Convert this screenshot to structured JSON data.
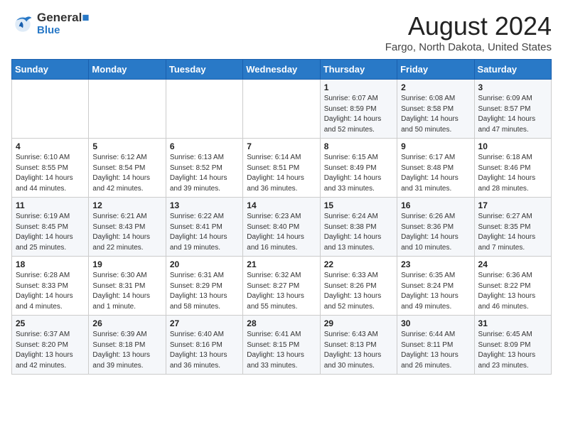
{
  "header": {
    "logo_line1": "General",
    "logo_line2": "Blue",
    "title": "August 2024",
    "subtitle": "Fargo, North Dakota, United States"
  },
  "weekdays": [
    "Sunday",
    "Monday",
    "Tuesday",
    "Wednesday",
    "Thursday",
    "Friday",
    "Saturday"
  ],
  "weeks": [
    [
      {
        "day": "",
        "info": ""
      },
      {
        "day": "",
        "info": ""
      },
      {
        "day": "",
        "info": ""
      },
      {
        "day": "",
        "info": ""
      },
      {
        "day": "1",
        "info": "Sunrise: 6:07 AM\nSunset: 8:59 PM\nDaylight: 14 hours\nand 52 minutes."
      },
      {
        "day": "2",
        "info": "Sunrise: 6:08 AM\nSunset: 8:58 PM\nDaylight: 14 hours\nand 50 minutes."
      },
      {
        "day": "3",
        "info": "Sunrise: 6:09 AM\nSunset: 8:57 PM\nDaylight: 14 hours\nand 47 minutes."
      }
    ],
    [
      {
        "day": "4",
        "info": "Sunrise: 6:10 AM\nSunset: 8:55 PM\nDaylight: 14 hours\nand 44 minutes."
      },
      {
        "day": "5",
        "info": "Sunrise: 6:12 AM\nSunset: 8:54 PM\nDaylight: 14 hours\nand 42 minutes."
      },
      {
        "day": "6",
        "info": "Sunrise: 6:13 AM\nSunset: 8:52 PM\nDaylight: 14 hours\nand 39 minutes."
      },
      {
        "day": "7",
        "info": "Sunrise: 6:14 AM\nSunset: 8:51 PM\nDaylight: 14 hours\nand 36 minutes."
      },
      {
        "day": "8",
        "info": "Sunrise: 6:15 AM\nSunset: 8:49 PM\nDaylight: 14 hours\nand 33 minutes."
      },
      {
        "day": "9",
        "info": "Sunrise: 6:17 AM\nSunset: 8:48 PM\nDaylight: 14 hours\nand 31 minutes."
      },
      {
        "day": "10",
        "info": "Sunrise: 6:18 AM\nSunset: 8:46 PM\nDaylight: 14 hours\nand 28 minutes."
      }
    ],
    [
      {
        "day": "11",
        "info": "Sunrise: 6:19 AM\nSunset: 8:45 PM\nDaylight: 14 hours\nand 25 minutes."
      },
      {
        "day": "12",
        "info": "Sunrise: 6:21 AM\nSunset: 8:43 PM\nDaylight: 14 hours\nand 22 minutes."
      },
      {
        "day": "13",
        "info": "Sunrise: 6:22 AM\nSunset: 8:41 PM\nDaylight: 14 hours\nand 19 minutes."
      },
      {
        "day": "14",
        "info": "Sunrise: 6:23 AM\nSunset: 8:40 PM\nDaylight: 14 hours\nand 16 minutes."
      },
      {
        "day": "15",
        "info": "Sunrise: 6:24 AM\nSunset: 8:38 PM\nDaylight: 14 hours\nand 13 minutes."
      },
      {
        "day": "16",
        "info": "Sunrise: 6:26 AM\nSunset: 8:36 PM\nDaylight: 14 hours\nand 10 minutes."
      },
      {
        "day": "17",
        "info": "Sunrise: 6:27 AM\nSunset: 8:35 PM\nDaylight: 14 hours\nand 7 minutes."
      }
    ],
    [
      {
        "day": "18",
        "info": "Sunrise: 6:28 AM\nSunset: 8:33 PM\nDaylight: 14 hours\nand 4 minutes."
      },
      {
        "day": "19",
        "info": "Sunrise: 6:30 AM\nSunset: 8:31 PM\nDaylight: 14 hours\nand 1 minute."
      },
      {
        "day": "20",
        "info": "Sunrise: 6:31 AM\nSunset: 8:29 PM\nDaylight: 13 hours\nand 58 minutes."
      },
      {
        "day": "21",
        "info": "Sunrise: 6:32 AM\nSunset: 8:27 PM\nDaylight: 13 hours\nand 55 minutes."
      },
      {
        "day": "22",
        "info": "Sunrise: 6:33 AM\nSunset: 8:26 PM\nDaylight: 13 hours\nand 52 minutes."
      },
      {
        "day": "23",
        "info": "Sunrise: 6:35 AM\nSunset: 8:24 PM\nDaylight: 13 hours\nand 49 minutes."
      },
      {
        "day": "24",
        "info": "Sunrise: 6:36 AM\nSunset: 8:22 PM\nDaylight: 13 hours\nand 46 minutes."
      }
    ],
    [
      {
        "day": "25",
        "info": "Sunrise: 6:37 AM\nSunset: 8:20 PM\nDaylight: 13 hours\nand 42 minutes."
      },
      {
        "day": "26",
        "info": "Sunrise: 6:39 AM\nSunset: 8:18 PM\nDaylight: 13 hours\nand 39 minutes."
      },
      {
        "day": "27",
        "info": "Sunrise: 6:40 AM\nSunset: 8:16 PM\nDaylight: 13 hours\nand 36 minutes."
      },
      {
        "day": "28",
        "info": "Sunrise: 6:41 AM\nSunset: 8:15 PM\nDaylight: 13 hours\nand 33 minutes."
      },
      {
        "day": "29",
        "info": "Sunrise: 6:43 AM\nSunset: 8:13 PM\nDaylight: 13 hours\nand 30 minutes."
      },
      {
        "day": "30",
        "info": "Sunrise: 6:44 AM\nSunset: 8:11 PM\nDaylight: 13 hours\nand 26 minutes."
      },
      {
        "day": "31",
        "info": "Sunrise: 6:45 AM\nSunset: 8:09 PM\nDaylight: 13 hours\nand 23 minutes."
      }
    ]
  ]
}
